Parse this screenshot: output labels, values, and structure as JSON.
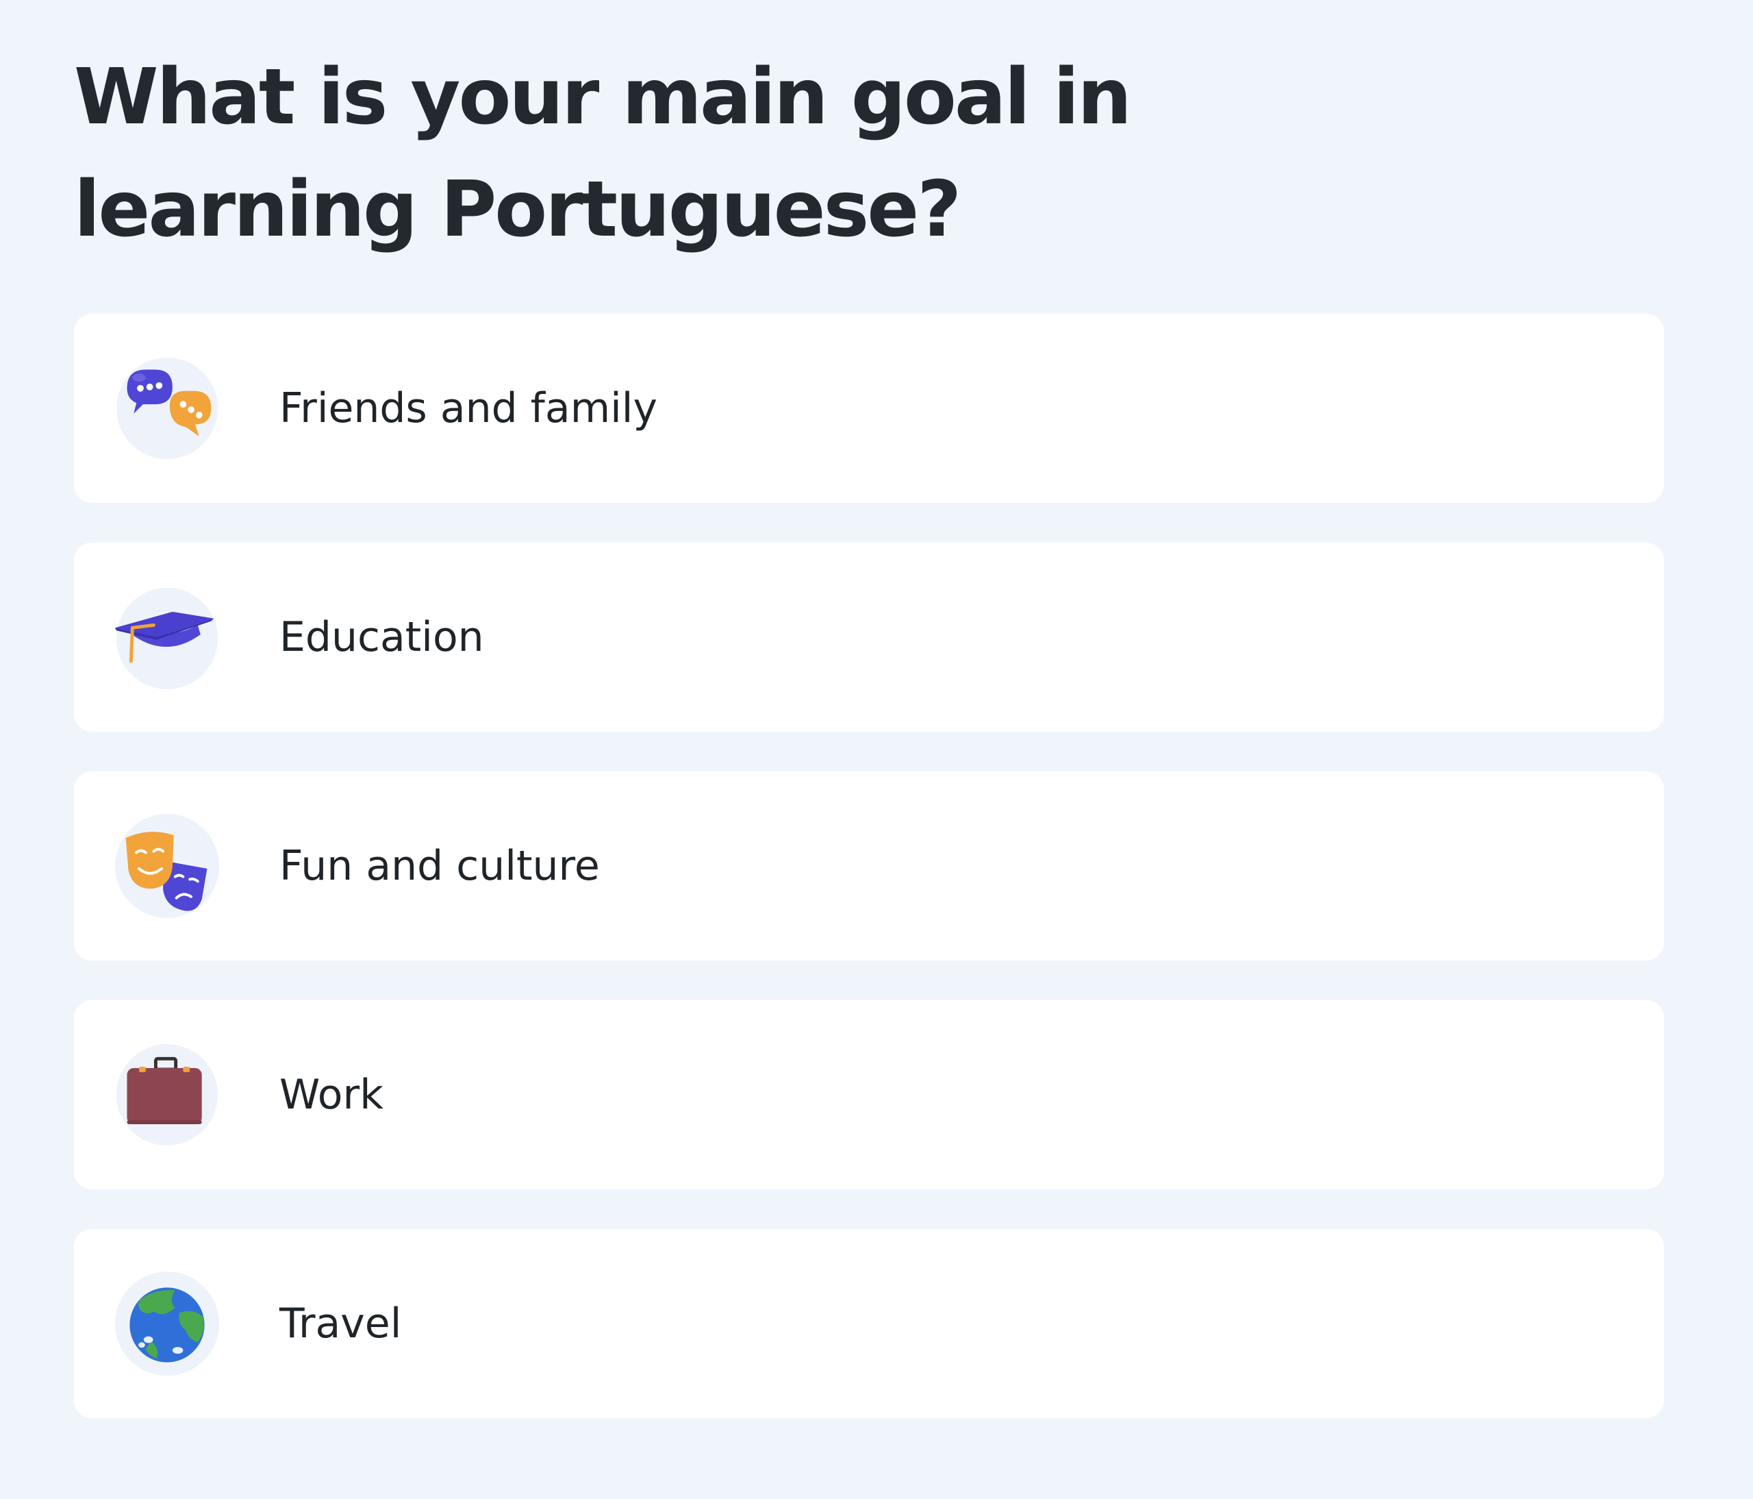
{
  "question": {
    "title": "What is your main goal in learning Portuguese?"
  },
  "options": [
    {
      "label": "Friends and family",
      "icon": "chat-bubbles-icon"
    },
    {
      "label": "Education",
      "icon": "graduation-cap-icon"
    },
    {
      "label": "Fun and culture",
      "icon": "theater-masks-icon"
    },
    {
      "label": "Work",
      "icon": "briefcase-icon"
    },
    {
      "label": "Travel",
      "icon": "globe-icon"
    }
  ],
  "colors": {
    "page_background": "#f0f5fc",
    "card_background": "#ffffff",
    "icon_circle": "#eef3fb",
    "purple": "#5046d6",
    "orange": "#f2a33a",
    "briefcase": "#8e4552",
    "globe_ocean": "#2f6fd8",
    "globe_land": "#4aa84f",
    "text": "#1f2429"
  }
}
